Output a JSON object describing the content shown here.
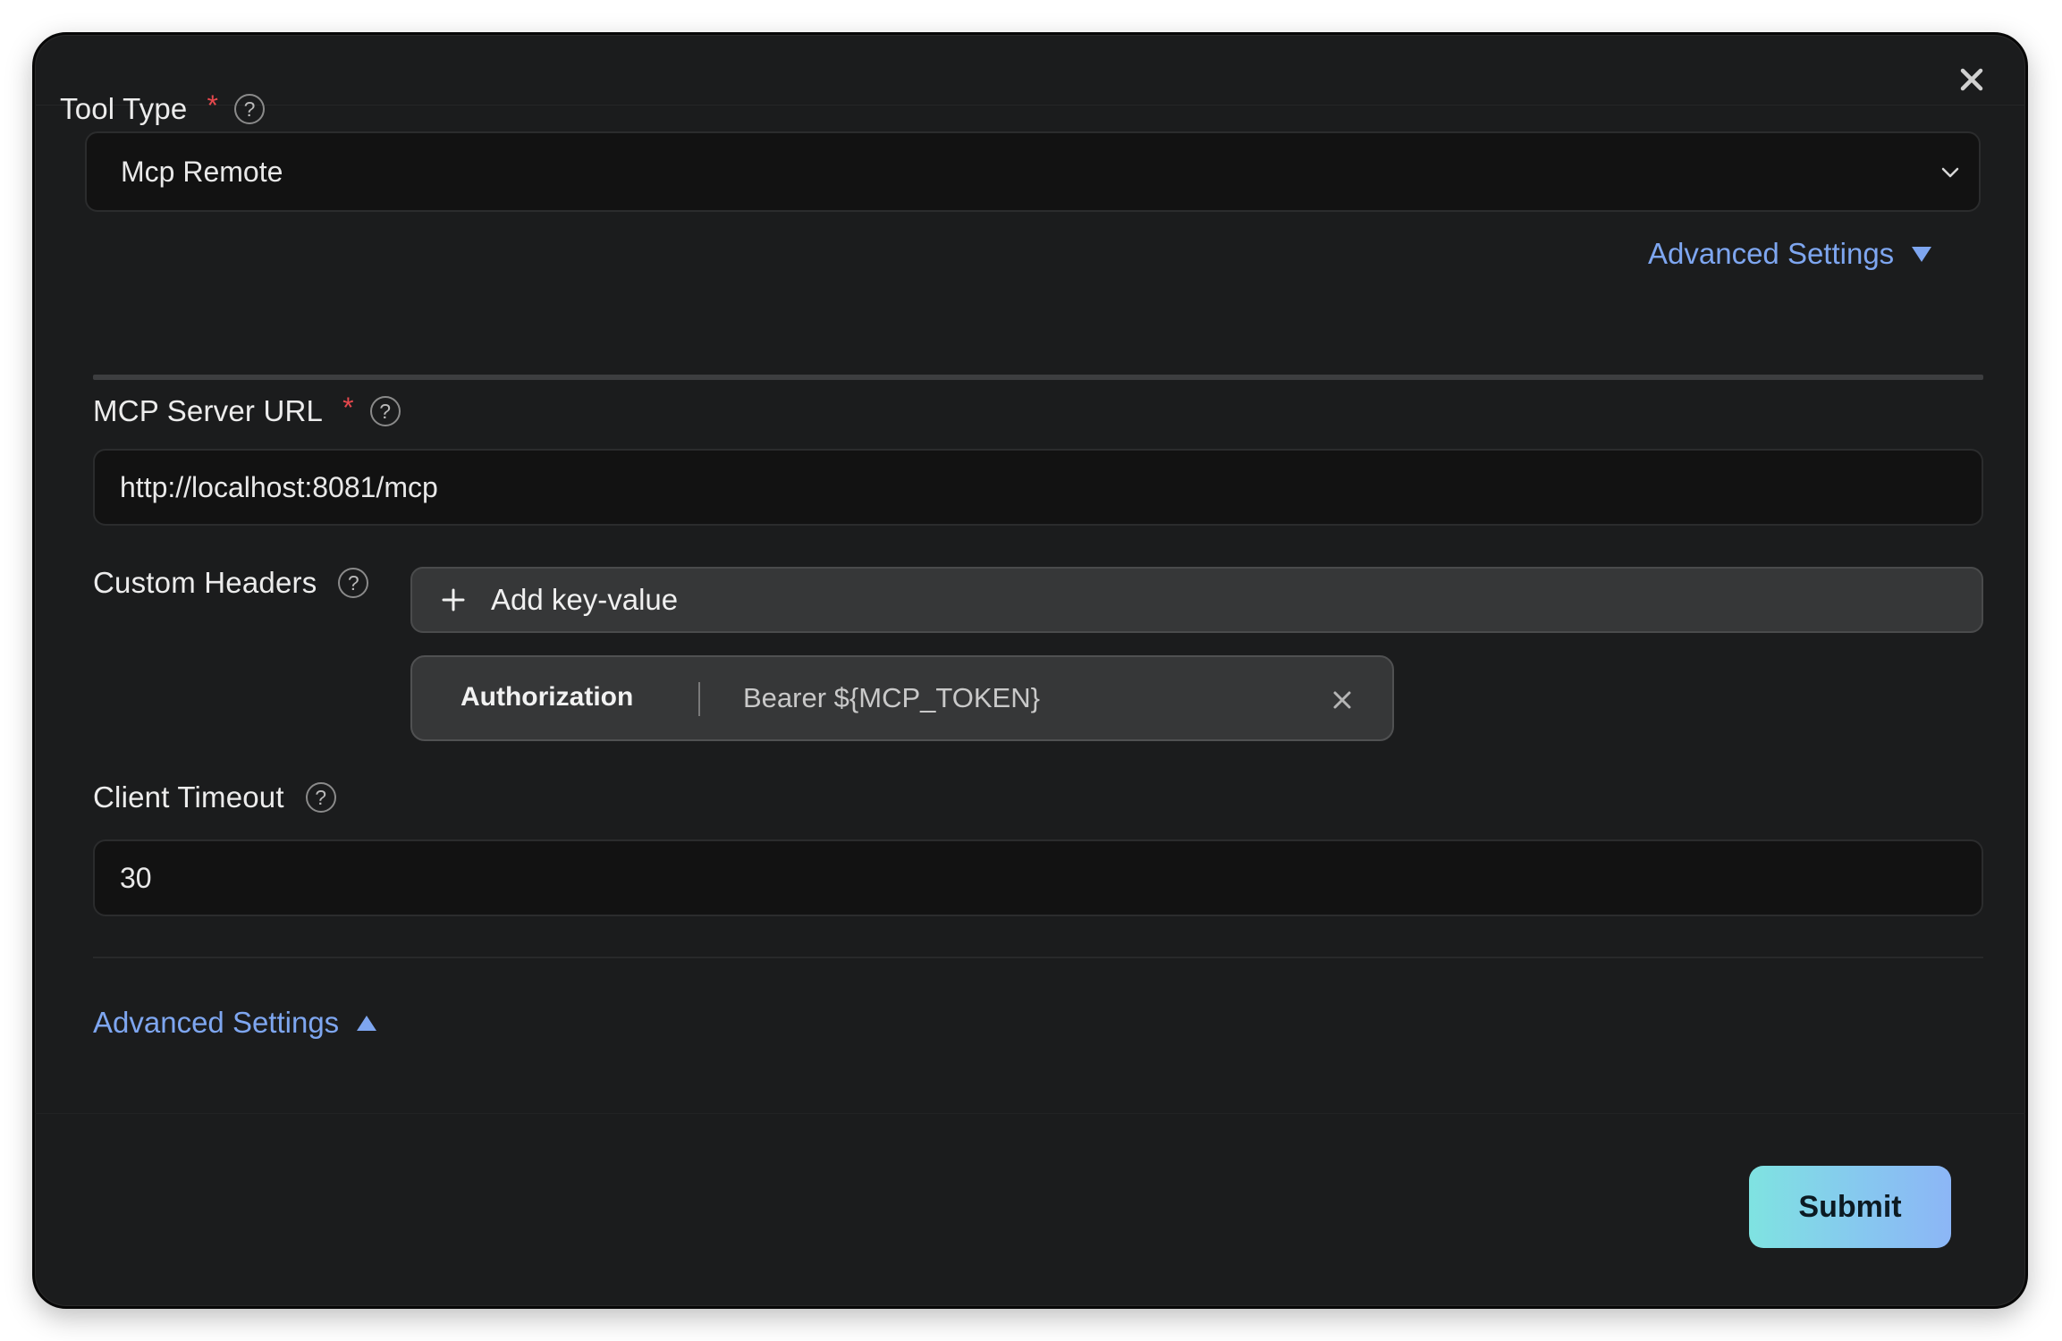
{
  "tool_type": {
    "label": "Tool Type",
    "required_mark": "*",
    "help": "?",
    "selected_value": "Mcp Remote"
  },
  "advanced_settings_top": {
    "label": "Advanced Settings",
    "state": "collapsed"
  },
  "mcp_server_url": {
    "label": "MCP Server URL",
    "required_mark": "*",
    "help": "?",
    "value": "http://localhost:8081/mcp"
  },
  "custom_headers": {
    "label": "Custom Headers",
    "help": "?",
    "add_label": "Add key-value",
    "items": [
      {
        "key": "Authorization",
        "value": "Bearer ${MCP_TOKEN}"
      }
    ]
  },
  "client_timeout": {
    "label": "Client Timeout",
    "help": "?",
    "value": "30"
  },
  "advanced_settings_bottom": {
    "label": "Advanced Settings",
    "state": "expanded"
  },
  "footer": {
    "submit_label": "Submit"
  },
  "icons": {
    "close": "close-icon",
    "select_chevron": "chevron-down-icon",
    "add": "plus-icon",
    "remove": "close-icon",
    "expand_down": "triangle-down-icon",
    "collapse_up": "triangle-up-icon"
  },
  "colors": {
    "accent_link": "#7ea6f0",
    "required": "#e5484d",
    "submit_gradient_start": "#7fe3e1",
    "submit_gradient_end": "#8cb6f6",
    "background": "#1b1c1d"
  }
}
